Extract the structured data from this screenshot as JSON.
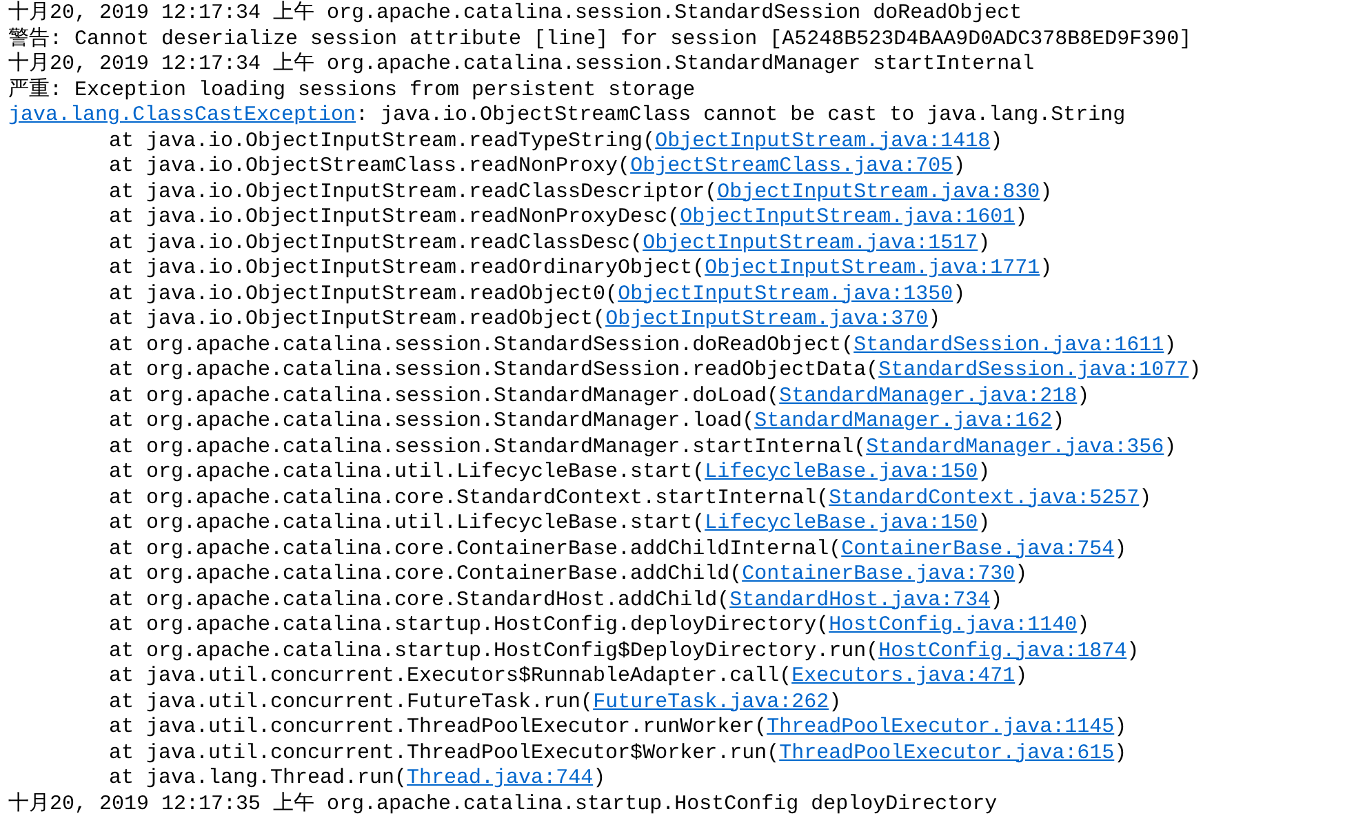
{
  "console": {
    "lines": [
      {
        "kind": "log",
        "before": "十月20, 2019 12:17:34 上午 org.apache.catalina.session.StandardSession doReadObject"
      },
      {
        "kind": "log",
        "before": "警告: Cannot deserialize session attribute [line] for session [A5248B523D4BAA9D0ADC378B8ED9F390]"
      },
      {
        "kind": "log",
        "before": "十月20, 2019 12:17:34 上午 org.apache.catalina.session.StandardManager startInternal"
      },
      {
        "kind": "log",
        "before": "严重: Exception loading sessions from persistent storage"
      },
      {
        "kind": "log",
        "link": "java.lang.ClassCastException",
        "after": ": java.io.ObjectStreamClass cannot be cast to java.lang.String"
      },
      {
        "kind": "trace",
        "before": "at java.io.ObjectInputStream.readTypeString(",
        "link": "ObjectInputStream.java:1418",
        "after": ")"
      },
      {
        "kind": "trace",
        "before": "at java.io.ObjectStreamClass.readNonProxy(",
        "link": "ObjectStreamClass.java:705",
        "after": ")"
      },
      {
        "kind": "trace",
        "before": "at java.io.ObjectInputStream.readClassDescriptor(",
        "link": "ObjectInputStream.java:830",
        "after": ")"
      },
      {
        "kind": "trace",
        "before": "at java.io.ObjectInputStream.readNonProxyDesc(",
        "link": "ObjectInputStream.java:1601",
        "after": ")"
      },
      {
        "kind": "trace",
        "before": "at java.io.ObjectInputStream.readClassDesc(",
        "link": "ObjectInputStream.java:1517",
        "after": ")"
      },
      {
        "kind": "trace",
        "before": "at java.io.ObjectInputStream.readOrdinaryObject(",
        "link": "ObjectInputStream.java:1771",
        "after": ")"
      },
      {
        "kind": "trace",
        "before": "at java.io.ObjectInputStream.readObject0(",
        "link": "ObjectInputStream.java:1350",
        "after": ")"
      },
      {
        "kind": "trace",
        "before": "at java.io.ObjectInputStream.readObject(",
        "link": "ObjectInputStream.java:370",
        "after": ")"
      },
      {
        "kind": "trace",
        "before": "at org.apache.catalina.session.StandardSession.doReadObject(",
        "link": "StandardSession.java:1611",
        "after": ")"
      },
      {
        "kind": "trace",
        "before": "at org.apache.catalina.session.StandardSession.readObjectData(",
        "link": "StandardSession.java:1077",
        "after": ")"
      },
      {
        "kind": "trace",
        "before": "at org.apache.catalina.session.StandardManager.doLoad(",
        "link": "StandardManager.java:218",
        "after": ")"
      },
      {
        "kind": "trace",
        "before": "at org.apache.catalina.session.StandardManager.load(",
        "link": "StandardManager.java:162",
        "after": ")"
      },
      {
        "kind": "trace",
        "before": "at org.apache.catalina.session.StandardManager.startInternal(",
        "link": "StandardManager.java:356",
        "after": ")"
      },
      {
        "kind": "trace",
        "before": "at org.apache.catalina.util.LifecycleBase.start(",
        "link": "LifecycleBase.java:150",
        "after": ")"
      },
      {
        "kind": "trace",
        "before": "at org.apache.catalina.core.StandardContext.startInternal(",
        "link": "StandardContext.java:5257",
        "after": ")"
      },
      {
        "kind": "trace",
        "before": "at org.apache.catalina.util.LifecycleBase.start(",
        "link": "LifecycleBase.java:150",
        "after": ")"
      },
      {
        "kind": "trace",
        "before": "at org.apache.catalina.core.ContainerBase.addChildInternal(",
        "link": "ContainerBase.java:754",
        "after": ")"
      },
      {
        "kind": "trace",
        "before": "at org.apache.catalina.core.ContainerBase.addChild(",
        "link": "ContainerBase.java:730",
        "after": ")"
      },
      {
        "kind": "trace",
        "before": "at org.apache.catalina.core.StandardHost.addChild(",
        "link": "StandardHost.java:734",
        "after": ")"
      },
      {
        "kind": "trace",
        "before": "at org.apache.catalina.startup.HostConfig.deployDirectory(",
        "link": "HostConfig.java:1140",
        "after": ")"
      },
      {
        "kind": "trace",
        "before": "at org.apache.catalina.startup.HostConfig$DeployDirectory.run(",
        "link": "HostConfig.java:1874",
        "after": ")"
      },
      {
        "kind": "trace",
        "before": "at java.util.concurrent.Executors$RunnableAdapter.call(",
        "link": "Executors.java:471",
        "after": ")"
      },
      {
        "kind": "trace",
        "before": "at java.util.concurrent.FutureTask.run(",
        "link": "FutureTask.java:262",
        "after": ")"
      },
      {
        "kind": "trace",
        "before": "at java.util.concurrent.ThreadPoolExecutor.runWorker(",
        "link": "ThreadPoolExecutor.java:1145",
        "after": ")"
      },
      {
        "kind": "trace",
        "before": "at java.util.concurrent.ThreadPoolExecutor$Worker.run(",
        "link": "ThreadPoolExecutor.java:615",
        "after": ")"
      },
      {
        "kind": "trace",
        "before": "at java.lang.Thread.run(",
        "link": "Thread.java:744",
        "after": ")"
      },
      {
        "kind": "log",
        "before": "十月20, 2019 12:17:35 上午 org.apache.catalina.startup.HostConfig deployDirectory"
      }
    ]
  }
}
